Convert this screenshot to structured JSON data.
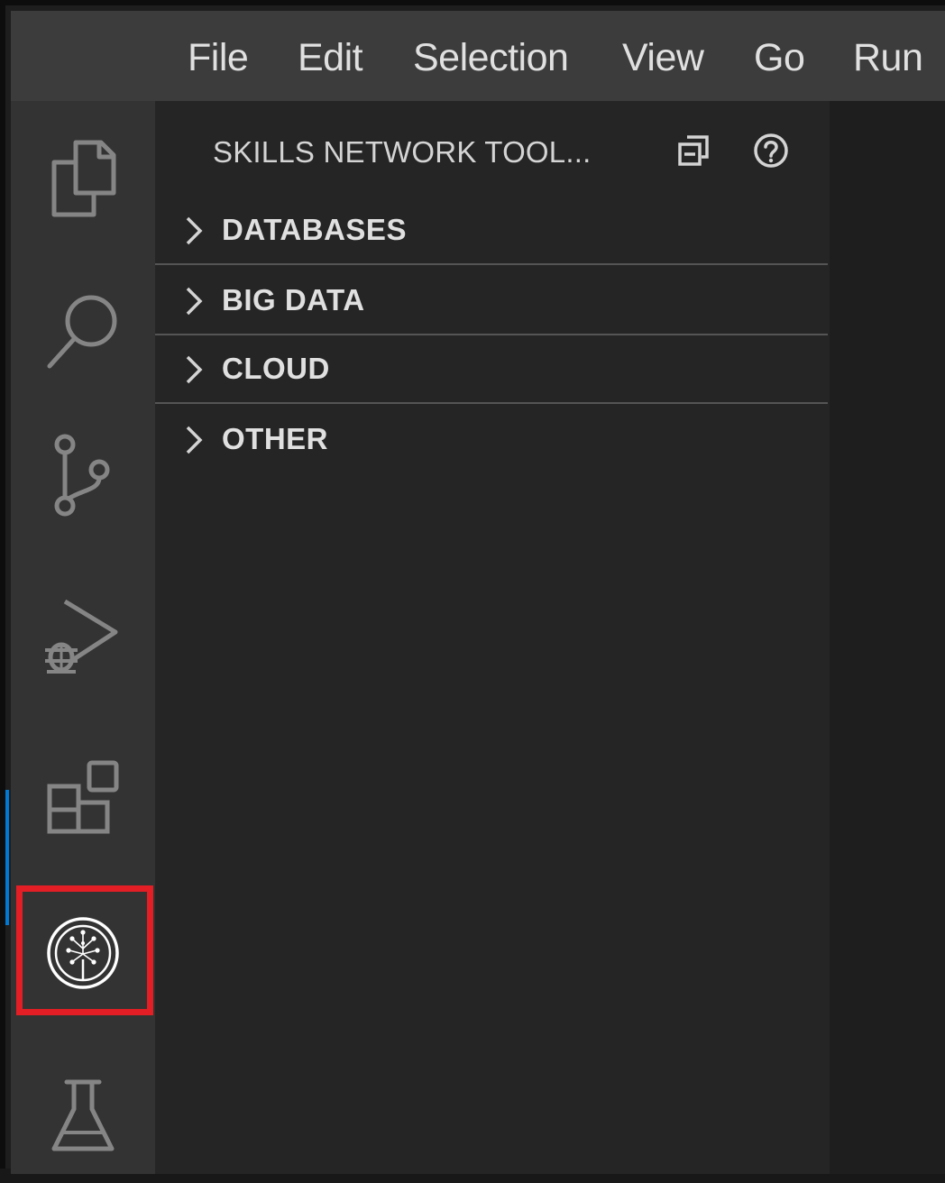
{
  "menu": {
    "items": [
      "File",
      "Edit",
      "Selection",
      "View",
      "Go",
      "Run"
    ]
  },
  "activity_bar": {
    "icons": [
      "explorer-icon",
      "search-icon",
      "source-control-icon",
      "run-debug-icon",
      "extensions-icon",
      "skills-network-icon",
      "testing-icon"
    ],
    "active": "skills-network-icon",
    "highlight_color": "#e31e24"
  },
  "sidebar": {
    "title": "SKILLS NETWORK TOOL...",
    "actions": [
      "collapse-all-icon",
      "help-icon"
    ],
    "sections": [
      {
        "label": "DATABASES"
      },
      {
        "label": "BIG DATA"
      },
      {
        "label": "CLOUD"
      },
      {
        "label": "OTHER"
      }
    ]
  },
  "colors": {
    "menubar_bg": "#3c3c3c",
    "activitybar_bg": "#333333",
    "sidebar_bg": "#252526",
    "editor_bg": "#1e1e1e",
    "accent": "#0078d4"
  }
}
